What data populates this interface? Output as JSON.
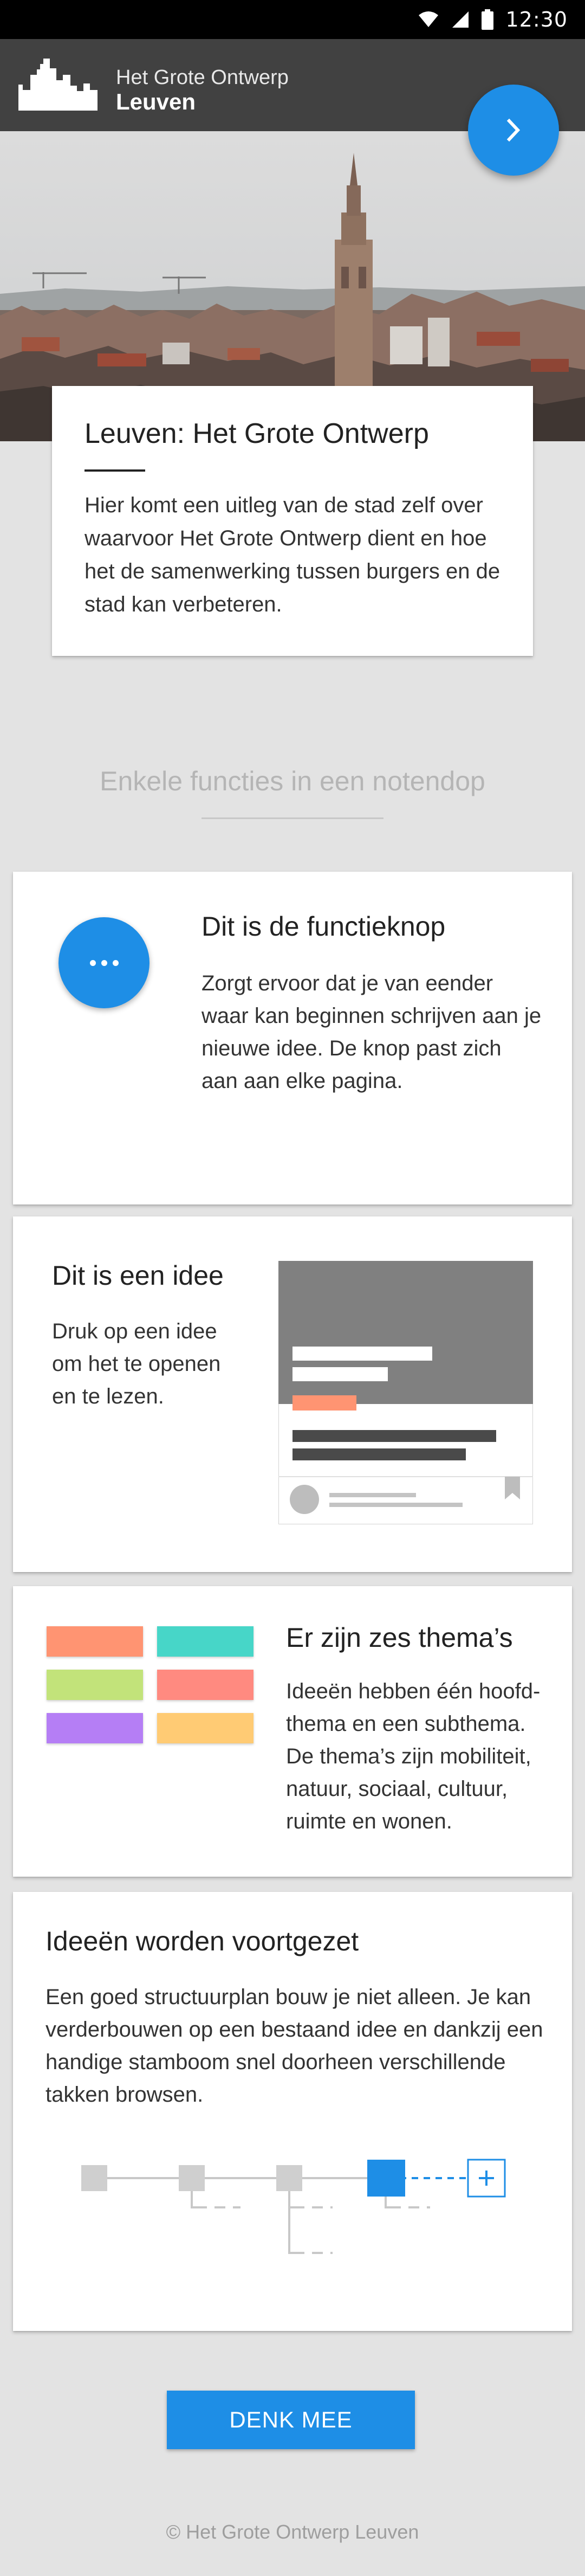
{
  "status_bar": {
    "time": "12:30"
  },
  "app_bar": {
    "title_line1": "Het Grote Ontwerp",
    "title_line2": "Leuven"
  },
  "intro": {
    "title": "Leuven: Het Grote Ontwerp",
    "text": "Hier komt een uitleg van de stad zelf over waarvoor Het Grote Ontwerp dient en hoe het de samenwerking tussen burgers en de stad kan verbeteren."
  },
  "section": {
    "title": "Enkele functies in een notendop"
  },
  "features": [
    {
      "title": "Dit is de functieknop",
      "text": "Zorgt ervoor dat je van eender waar kan beginnen schrijven aan je nieuwe idee. De knop past zich aan aan elke pagina."
    },
    {
      "title": "Dit is een idee",
      "text": "Druk op een idee om het te openen en te lezen."
    },
    {
      "title": "Er zijn zes thema’s",
      "text": "Ideeën hebben één hoofd-thema en een subthema. De thema’s zijn mobiliteit, natuur, sociaal, cultuur, ruimte en wonen."
    },
    {
      "title": "Ideeën worden voortgezet",
      "text": "Een goed structuurplan bouw je niet alleen. Je kan verderbouwen op een bestaand idee en dankzij een handige stamboom snel doorheen verschillende takken browsen."
    }
  ],
  "theme_colors": [
    "#ff9472",
    "#47d6c8",
    "#c2e37a",
    "#ff8a80",
    "#b57ef5",
    "#ffcb74"
  ],
  "accent_color": "#1e8ee6",
  "cta": {
    "label": "DENK MEE"
  },
  "footer": {
    "text": "© Het Grote Ontwerp Leuven"
  }
}
